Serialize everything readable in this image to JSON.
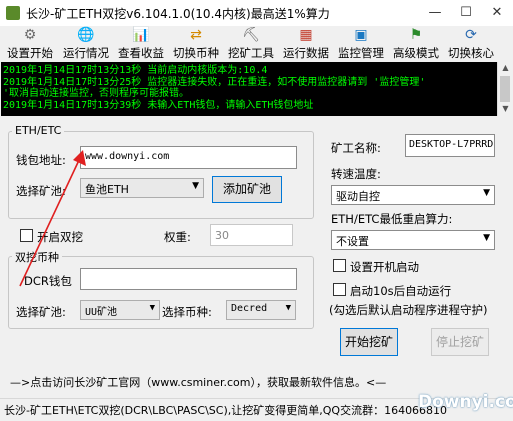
{
  "window": {
    "title": "长沙-矿工ETH双挖v6.104.1.0(10.4内核)最高送1%算力",
    "minimize": "—",
    "maximize": "☐",
    "close": "✕"
  },
  "toolbar": {
    "items": [
      {
        "label": "设置开始",
        "icon": "gear-icon",
        "glyph": "⚙",
        "color": "#6b6b6b"
      },
      {
        "label": "运行情况",
        "icon": "globe-icon",
        "glyph": "🌐",
        "color": "#1a78c2"
      },
      {
        "label": "查看收益",
        "icon": "chart-icon",
        "glyph": "📊",
        "color": "#2a8a2a"
      },
      {
        "label": "切换币种",
        "icon": "swap-icon",
        "glyph": "⇄",
        "color": "#d48a00"
      },
      {
        "label": "挖矿工具",
        "icon": "tools-icon",
        "glyph": "⛏",
        "color": "#6b6b6b"
      },
      {
        "label": "运行数据",
        "icon": "calendar-icon",
        "glyph": "▦",
        "color": "#c23a2a"
      },
      {
        "label": "监控管理",
        "icon": "monitor-icon",
        "glyph": "▣",
        "color": "#1a78c2"
      },
      {
        "label": "高级模式",
        "icon": "advanced-icon",
        "glyph": "⚑",
        "color": "#2a8a2a"
      },
      {
        "label": "切换核心",
        "icon": "core-icon",
        "glyph": "⟳",
        "color": "#2a6ab0"
      }
    ]
  },
  "log": {
    "lines": [
      "2019年1月14日17时13分13秒 当前启动内核版本为:10.4",
      "2019年1月14日17时13分25秒 监控器连接失败，正在重连，如不使用监控器请到 '监控管理'",
      "'取消自动连接监控，否则程序可能报错。",
      "2019年1月14日17时13分39秒 未输入ETH钱包，请输入ETH钱包地址"
    ]
  },
  "eth_group": {
    "legend": "ETH/ETC",
    "wallet_label": "钱包地址:",
    "wallet_value": "www.downyi.com",
    "pool_label": "选择矿池:",
    "pool_value": "鱼池ETH",
    "add_pool_button": "添加矿池"
  },
  "dual": {
    "enable_label": "开启双挖",
    "weight_label": "权重:",
    "weight_value": "30"
  },
  "dual_group": {
    "legend": "双挖币种",
    "dcr_wallet_label": "DCR钱包",
    "pool_label": "选择矿池:",
    "pool_value": "UU矿池",
    "coin_label": "选择币种:",
    "coin_value": "Decred"
  },
  "right_panel": {
    "miner_name_label": "矿工名称:",
    "miner_name_value": "DESKTOP-L7PRRD",
    "fan_label": "转速温度:",
    "fan_value": "驱动自控",
    "min_hash_label": "ETH/ETC最低重启算力:",
    "min_hash_value": "不设置",
    "autostart_label": "设置开机启动",
    "delay_label": "启动10s后自动运行",
    "note": "(勾选后默认启动程序进程守护)",
    "start_button": "开始挖矿",
    "stop_button": "停止挖矿"
  },
  "footer": {
    "link_text": "—>点击访问长沙矿工官网（www.csminer.com），获取最新软件信息。<—",
    "status_text": "长沙-矿工ETH\\ETC双挖(DCR\\LBC\\PASC\\SC),让挖矿变得更简单,QQ交流群：164066810"
  },
  "watermark": "Downyi.com",
  "colors": {
    "log_text": "#00ff00",
    "log_bg": "#000000",
    "arrow": "#e02020",
    "primary_border": "#0078d7"
  }
}
